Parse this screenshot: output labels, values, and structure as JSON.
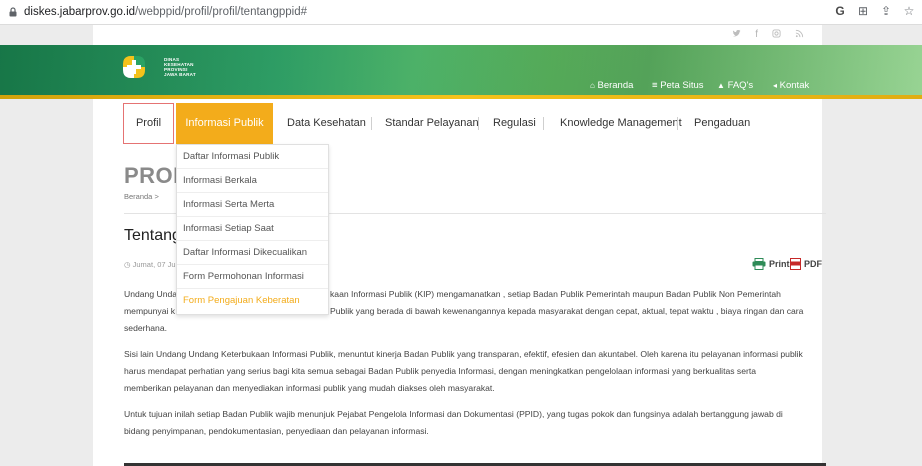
{
  "browser": {
    "url_host": "diskes.jabarprov.go.id",
    "url_path": "/webppid/profil/profil/tentangppid#",
    "icons": [
      "google-icon",
      "translate-icon",
      "share-icon",
      "star-icon"
    ],
    "icon_glyphs": [
      "G",
      "⊞",
      "⇪",
      "☆"
    ]
  },
  "social": {
    "icons": [
      "twitter-icon",
      "facebook-icon",
      "instagram-icon",
      "rss-icon"
    ],
    "glyphs": [
      "🐦",
      "f",
      "◎",
      "≈"
    ]
  },
  "header": {
    "logo_text": [
      "DINAS",
      "KESEHATAN",
      "PROVINSI",
      "JAWA BARAT"
    ],
    "top_nav": [
      {
        "label": "Beranda",
        "glyph": "🏠"
      },
      {
        "label": "Peta Situs",
        "glyph": "≡"
      },
      {
        "label": "FAQ's",
        "glyph": "👍"
      },
      {
        "label": "Kontak",
        "glyph": "✉"
      }
    ],
    "colors": {
      "green": "#2aa264",
      "yellow": "#f4c21b"
    }
  },
  "menu": {
    "items": [
      "Profil",
      "Informasi Publik",
      "Data Kesehatan",
      "Standar Pelayanan",
      "Regulasi",
      "Knowledge Management",
      "Pengaduan"
    ],
    "active": "Informasi Publik",
    "accent": "#f3ac1b"
  },
  "dropdown": {
    "items": [
      "Daftar Informasi Publik",
      "Informasi Berkala",
      "Informasi Serta Merta",
      "Informasi Setiap Saat",
      "Daftar Informasi Dikecualikan",
      "Form Permohonan Informasi",
      "Form Pengajuan Keberatan"
    ],
    "highlighted": "Form Pengajuan Keberatan"
  },
  "content": {
    "heading_visible": "PROF",
    "breadcrumb": "Beranda",
    "breadcrumb_sep": ">",
    "title_visible": "Tentang",
    "date_visible": "Jumat, 07 Ju",
    "print_label": "Print",
    "pdf_label": "PDF",
    "paragraphs": [
      [
        "Undang Unda",
        "kaan Informasi Publik (KIP)  mengamanatkan , setiap Badan Publik Pemerintah maupun Badan Publik Non Pemerintah"
      ],
      [
        "mempunyai k",
        "Publik yang berada di bawah  kewenangannya kepada masyarakat dengan cepat, aktual, tepat waktu , biaya ringan dan cara"
      ],
      "sederhana.",
      "Sisi lain Undang Undang Keterbukaan Informasi Publik, menuntut kinerja Badan Publik yang transparan, efektif, efesien dan akuntabel. Oleh karena itu pelayanan informasi publik",
      "harus mendapat perhatian yang serius bagi kita semua sebagai Badan Publik penyedia Informasi, dengan meningkatkan pengelolaan informasi yang berkualitas serta",
      "memberikan pelayanan dan menyediakan informasi publik yang mudah diakses oleh masyarakat.",
      "Untuk tujuan inilah setiap Badan Publik wajib menunjuk Pejabat Pengelola Informasi dan Dokumentasi (PPID), yang tugas pokok dan fungsinya adalah bertanggung jawab di",
      "bidang penyimpanan, pendokumentasian, penyediaan dan pelayanan informasi."
    ]
  }
}
